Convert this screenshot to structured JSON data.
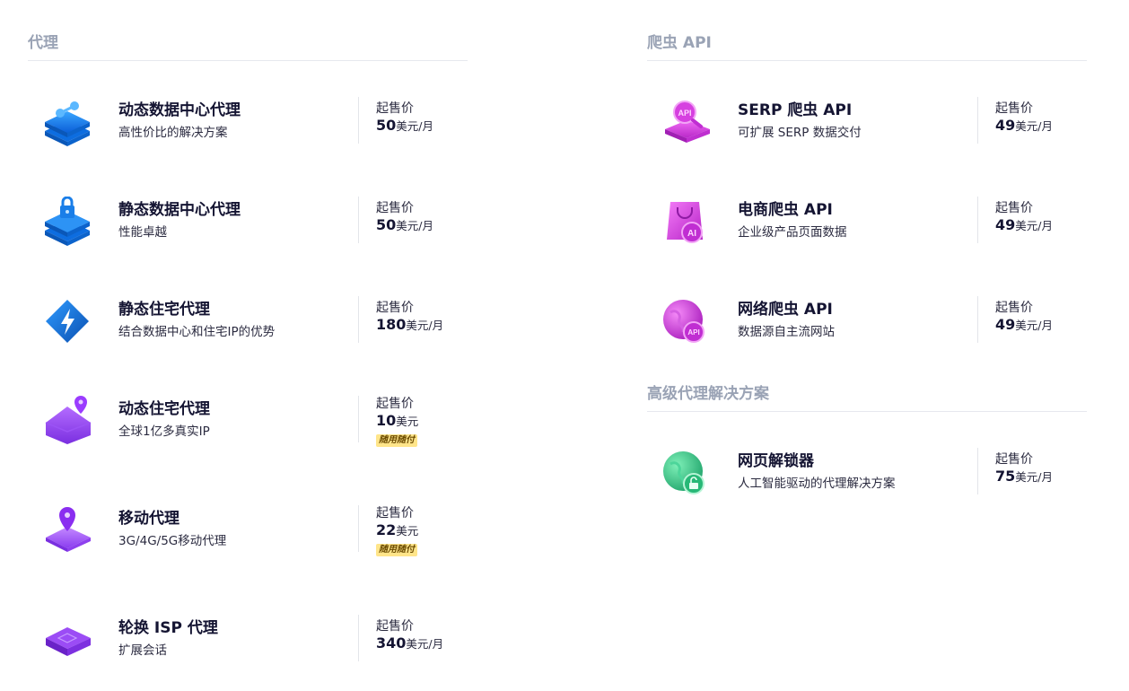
{
  "sections": {
    "proxy": "代理",
    "scraper": "爬虫 API",
    "advanced": "高级代理解决方案"
  },
  "price_label": "起售价",
  "products": {
    "dc_dynamic": {
      "name": "动态数据中心代理",
      "desc": "高性价比的解决方案",
      "amount": "50",
      "unit": "美元/月"
    },
    "dc_static": {
      "name": "静态数据中心代理",
      "desc": "性能卓越",
      "amount": "50",
      "unit": "美元/月"
    },
    "res_static": {
      "name": "静态住宅代理",
      "desc": "结合数据中心和住宅IP的优势",
      "amount": "180",
      "unit": "美元/月"
    },
    "res_dynamic": {
      "name": "动态住宅代理",
      "desc": "全球1亿多真实IP",
      "amount": "10",
      "unit": "美元",
      "badge": "随用随付"
    },
    "mobile": {
      "name": "移动代理",
      "desc": "3G/4G/5G移动代理",
      "amount": "22",
      "unit": "美元",
      "badge": "随用随付"
    },
    "isp": {
      "name": "轮换 ISP 代理",
      "desc": "扩展会话",
      "amount": "340",
      "unit": "美元/月"
    },
    "serp": {
      "name": "SERP 爬虫 API",
      "desc": "可扩展 SERP 数据交付",
      "amount": "49",
      "unit": "美元/月"
    },
    "ecom": {
      "name": "电商爬虫 API",
      "desc": "企业级产品页面数据",
      "amount": "49",
      "unit": "美元/月"
    },
    "web": {
      "name": "网络爬虫 API",
      "desc": "数据源自主流网站",
      "amount": "49",
      "unit": "美元/月"
    },
    "unlocker": {
      "name": "网页解锁器",
      "desc": "人工智能驱动的代理解决方案",
      "amount": "75",
      "unit": "美元/月"
    }
  },
  "icon_text": {
    "api": "API",
    "ai": "AI"
  },
  "colors": {
    "section_title": "#9aa3b5",
    "blue": "#1e7be6",
    "purple": "#8a3cf0",
    "magenta": "#d43ad8",
    "green": "#3cc98a",
    "badge_bg": "#ffe58a"
  }
}
